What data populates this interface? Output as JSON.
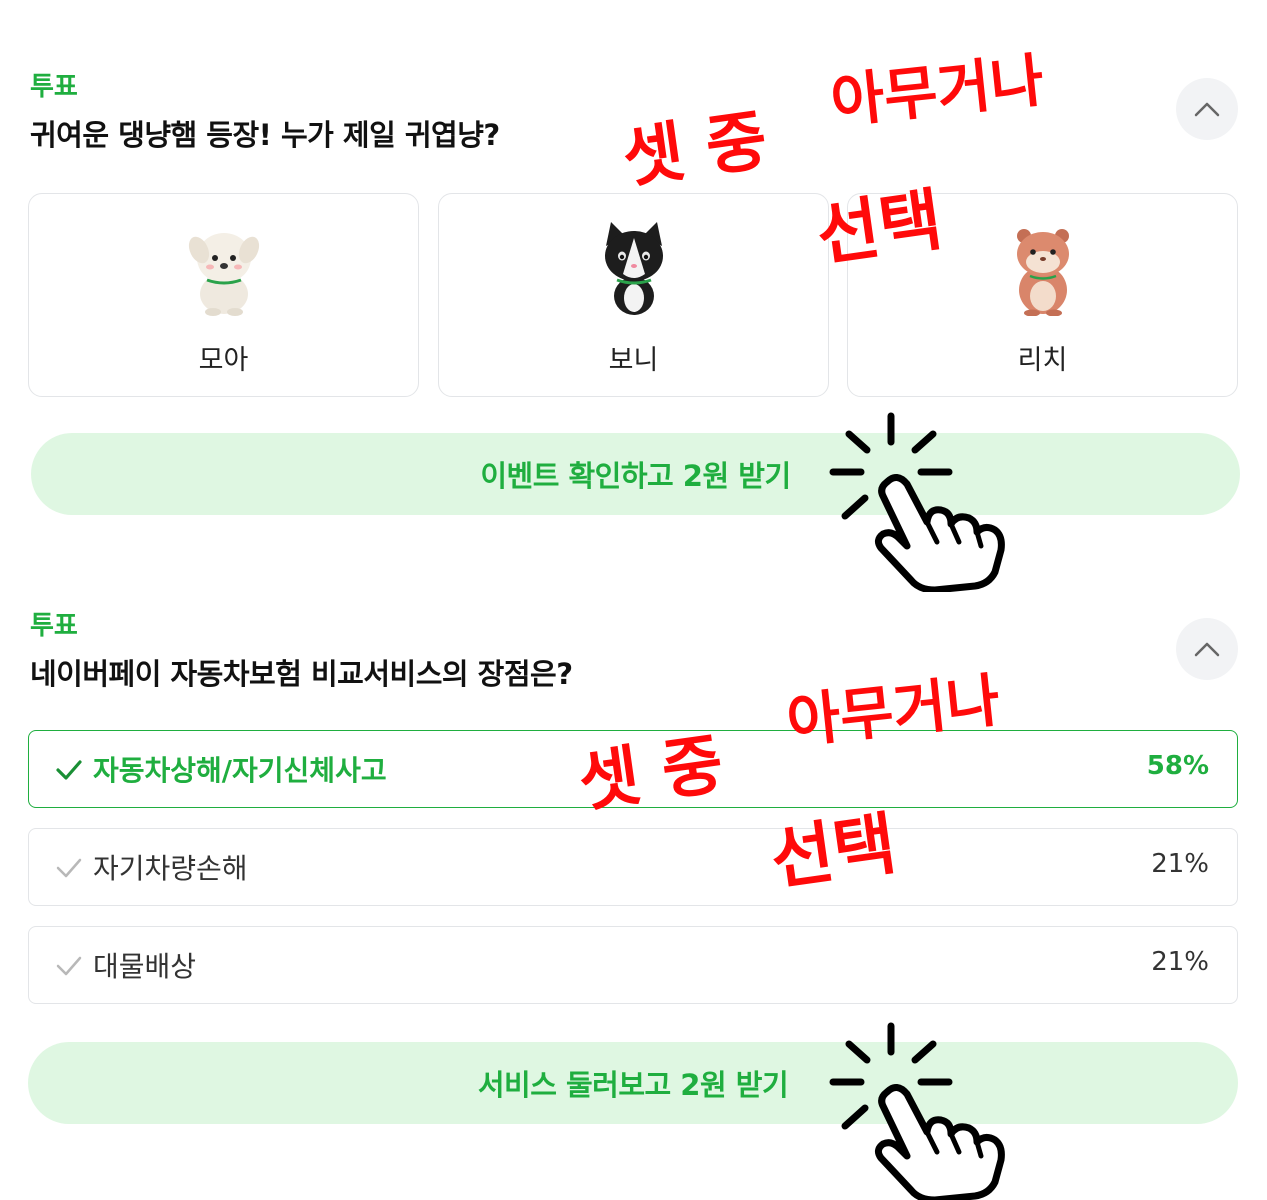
{
  "poll1": {
    "tag": "투표",
    "question": "귀여운 댕냥햄 등장! 누가 제일 귀엽냥?",
    "choices": [
      {
        "name": "모아",
        "icon": "puppy-icon"
      },
      {
        "name": "보니",
        "icon": "cat-icon"
      },
      {
        "name": "리치",
        "icon": "hamster-icon"
      }
    ],
    "cta": "이벤트 확인하고 2원 받기"
  },
  "poll2": {
    "tag": "투표",
    "question": "네이버페이 자동차보험 비교서비스의 장점은?",
    "options": [
      {
        "label": "자동차상해/자기신체사고",
        "percent": "58%",
        "selected": true
      },
      {
        "label": "자기차량손해",
        "percent": "21%",
        "selected": false
      },
      {
        "label": "대물배상",
        "percent": "21%",
        "selected": false
      }
    ],
    "cta": "서비스 둘러보고 2원 받기"
  },
  "annotations": {
    "line1a": "셋 중",
    "line1b": "아무거나",
    "line2": "선택",
    "color": "#ff0a0a"
  },
  "colors": {
    "accent": "#1fae3f",
    "cta_bg": "#dff7e2"
  }
}
